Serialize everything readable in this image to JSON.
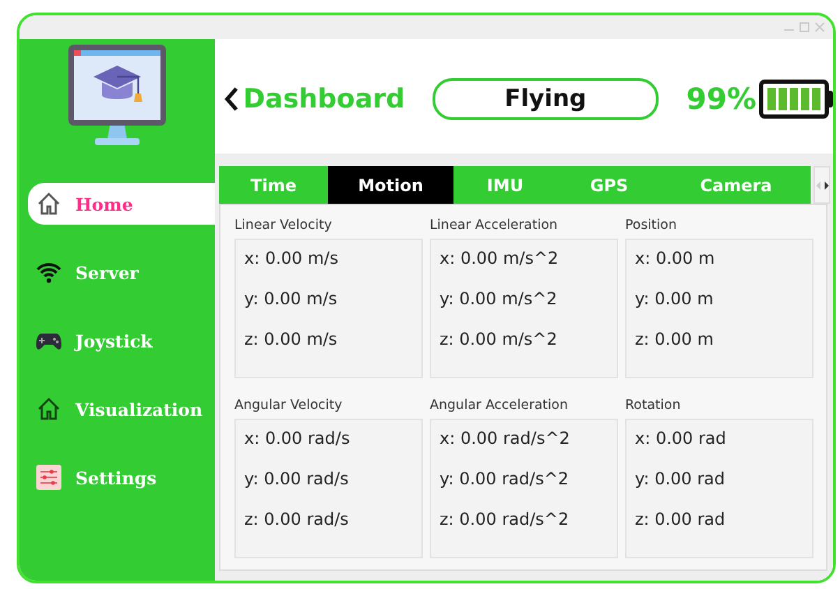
{
  "sidebar": {
    "items": [
      {
        "label": "Home",
        "selected": true
      },
      {
        "label": "Server",
        "selected": false
      },
      {
        "label": "Joystick",
        "selected": false
      },
      {
        "label": "Visualization",
        "selected": false
      },
      {
        "label": "Settings",
        "selected": false
      }
    ]
  },
  "header": {
    "title": "Dashboard",
    "status": "Flying",
    "battery": {
      "reading": "99%",
      "level": 0.99
    }
  },
  "tabs": [
    {
      "label": "Time",
      "selected": false
    },
    {
      "label": "Motion",
      "selected": true
    },
    {
      "label": "IMU",
      "selected": false
    },
    {
      "label": "GPS",
      "selected": false
    },
    {
      "label": "Camera",
      "selected": false
    }
  ],
  "groups": [
    {
      "title": "Linear Velocity",
      "lines": [
        "x: 0.00 m/s",
        "y: 0.00 m/s",
        "z: 0.00 m/s"
      ]
    },
    {
      "title": "Linear Acceleration",
      "lines": [
        "x: 0.00 m/s^2",
        "y: 0.00 m/s^2",
        "z: 0.00 m/s^2"
      ]
    },
    {
      "title": "Position",
      "lines": [
        "x: 0.00 m",
        "y: 0.00 m",
        "z: 0.00 m"
      ]
    },
    {
      "title": "Angular Velocity",
      "lines": [
        "x: 0.00 rad/s",
        "y: 0.00 rad/s",
        "z: 0.00 rad/s"
      ]
    },
    {
      "title": "Angular Acceleration",
      "lines": [
        "x: 0.00 rad/s^2",
        "y: 0.00 rad/s^2",
        "z: 0.00 rad/s^2"
      ]
    },
    {
      "title": "Rotation",
      "lines": [
        "x: 0.00 rad",
        "y: 0.00 rad",
        "z: 0.00 rad"
      ]
    }
  ]
}
